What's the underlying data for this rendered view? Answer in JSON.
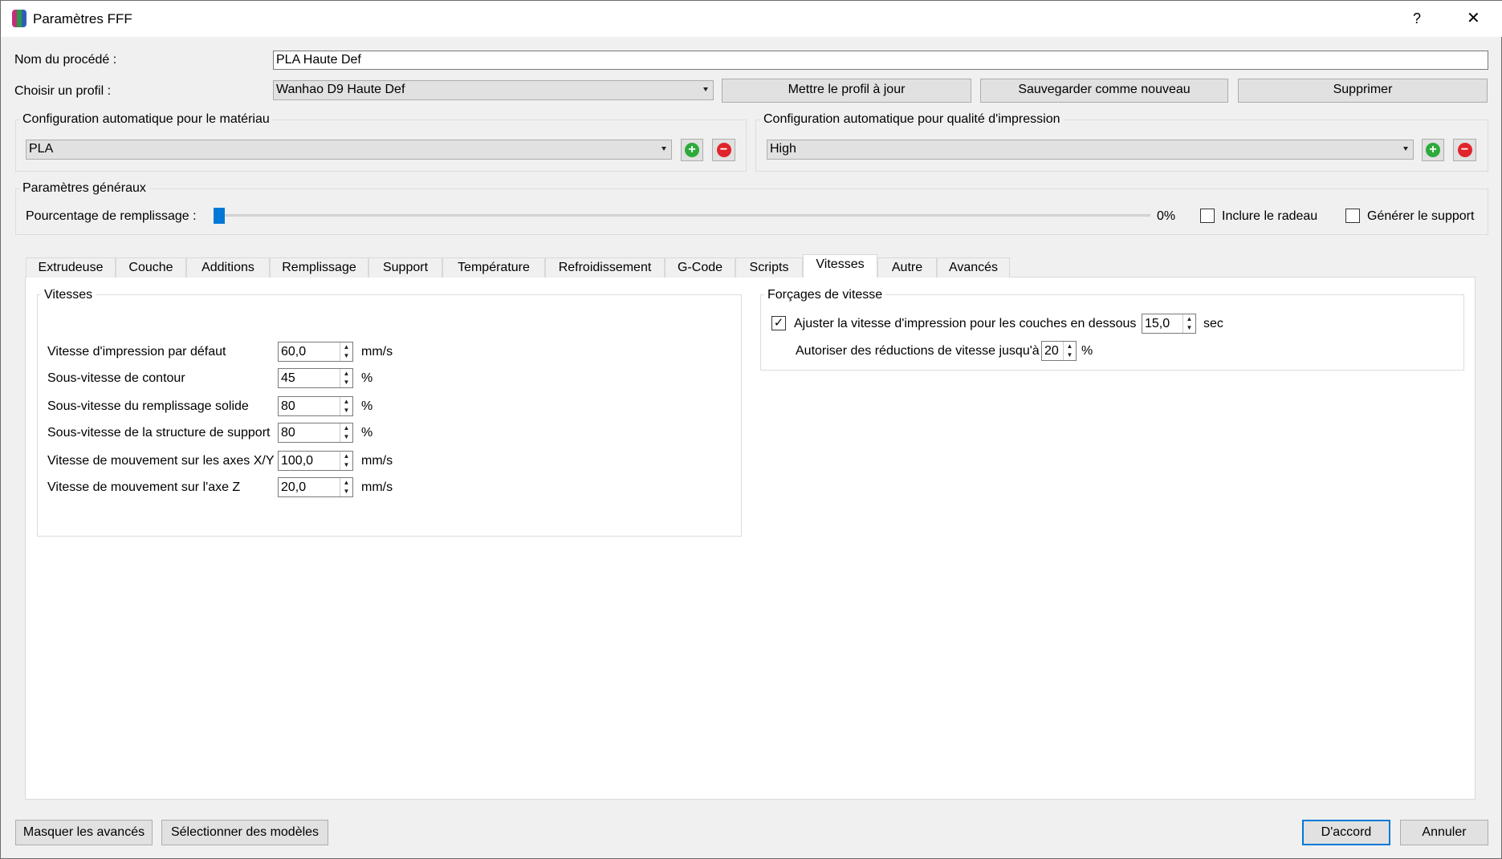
{
  "window": {
    "title": "Paramètres FFF",
    "help": "?",
    "close": "✕"
  },
  "process_name": {
    "label": "Nom du procédé :",
    "value": "PLA Haute Def"
  },
  "profile": {
    "label": "Choisir un profil :",
    "value": "Wanhao D9 Haute Def",
    "update": "Mettre le profil à jour",
    "save_new": "Sauvegarder comme nouveau",
    "delete": "Supprimer"
  },
  "material": {
    "title": "Configuration automatique pour le matériau",
    "value": "PLA"
  },
  "quality": {
    "title": "Configuration automatique pour qualité d'impression",
    "value": "High"
  },
  "general": {
    "title": "Paramètres généraux",
    "infill_label": "Pourcentage de remplissage :",
    "infill_value": "0%",
    "infill_fraction": 0,
    "raft_label": "Inclure le radeau",
    "raft_checked": false,
    "support_label": "Générer le support",
    "support_checked": false
  },
  "tabs": [
    "Extrudeuse",
    "Couche",
    "Additions",
    "Remplissage",
    "Support",
    "Température",
    "Refroidissement",
    "G-Code",
    "Scripts",
    "Vitesses",
    "Autre",
    "Avancés"
  ],
  "selected_tab": "Vitesses",
  "speeds": {
    "title": "Vitesses",
    "rows": [
      {
        "label": "Vitesse d'impression par défaut",
        "value": "60,0",
        "unit": "mm/s"
      },
      {
        "label": "Sous-vitesse de contour",
        "value": "45",
        "unit": "%"
      },
      {
        "label": "Sous-vitesse du remplissage solide",
        "value": "80",
        "unit": "%"
      },
      {
        "label": "Sous-vitesse de la structure de support",
        "value": "80",
        "unit": "%"
      },
      {
        "label": "Vitesse de mouvement sur les axes X/Y",
        "value": "100,0",
        "unit": "mm/s"
      },
      {
        "label": "Vitesse de mouvement sur l'axe Z",
        "value": "20,0",
        "unit": "mm/s"
      }
    ]
  },
  "overrides": {
    "title": "Forçages de vitesse",
    "adjust_label": "Ajuster la vitesse d'impression pour les couches en dessous",
    "adjust_checked": true,
    "adjust_value": "15,0",
    "adjust_unit": "sec",
    "reduce_label": "Autoriser des réductions de vitesse jusqu'à",
    "reduce_value": "20",
    "reduce_unit": "%"
  },
  "footer": {
    "hide_advanced": "Masquer les avancés",
    "select_models": "Sélectionner des modèles",
    "ok": "D'accord",
    "cancel": "Annuler"
  }
}
